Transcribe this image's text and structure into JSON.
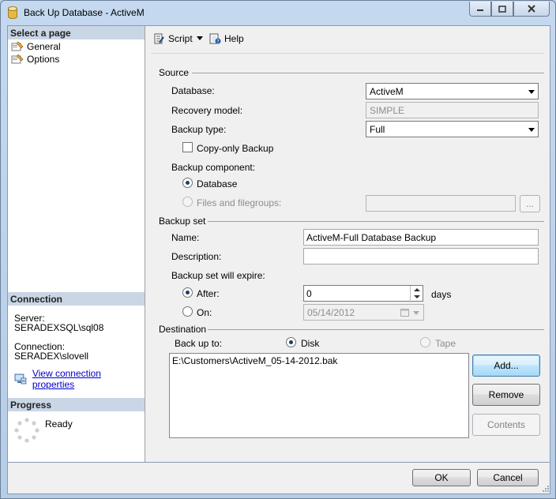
{
  "window": {
    "title": "Back Up Database - ActiveM",
    "accent": "#b9d1ea"
  },
  "left_pane": {
    "select_page_header": "Select a page",
    "pages": [
      {
        "label": "General",
        "icon": "page-icon"
      },
      {
        "label": "Options",
        "icon": "page-icon"
      }
    ],
    "connection_header": "Connection",
    "server_label": "Server:",
    "server_value": "SERADEXSQL\\sql08",
    "connection_label": "Connection:",
    "connection_value": "SERADEX\\slovell",
    "view_connection_link": "View connection properties",
    "progress_header": "Progress",
    "progress_status": "Ready"
  },
  "toolbar": {
    "script_label": "Script",
    "help_label": "Help"
  },
  "source": {
    "title": "Source",
    "database_label": "Database:",
    "database_value": "ActiveM",
    "recovery_label": "Recovery model:",
    "recovery_value": "SIMPLE",
    "backup_type_label": "Backup type:",
    "backup_type_value": "Full",
    "copy_only_label": "Copy-only Backup",
    "component_label": "Backup component:",
    "component_database": "Database",
    "component_files": "Files and filegroups:",
    "files_browse": "..."
  },
  "backup_set": {
    "title": "Backup set",
    "name_label": "Name:",
    "name_value": "ActiveM-Full Database Backup",
    "description_label": "Description:",
    "description_value": "",
    "expire_label": "Backup set will expire:",
    "after_label": "After:",
    "after_value": "0",
    "days_label": "days",
    "on_label": "On:",
    "on_value": "05/14/2012"
  },
  "destination": {
    "title": "Destination",
    "back_up_to_label": "Back up to:",
    "disk_label": "Disk",
    "tape_label": "Tape",
    "paths": [
      "E:\\Customers\\ActiveM_05-14-2012.bak"
    ],
    "add_label": "Add...",
    "remove_label": "Remove",
    "contents_label": "Contents"
  },
  "footer": {
    "ok_label": "OK",
    "cancel_label": "Cancel"
  }
}
